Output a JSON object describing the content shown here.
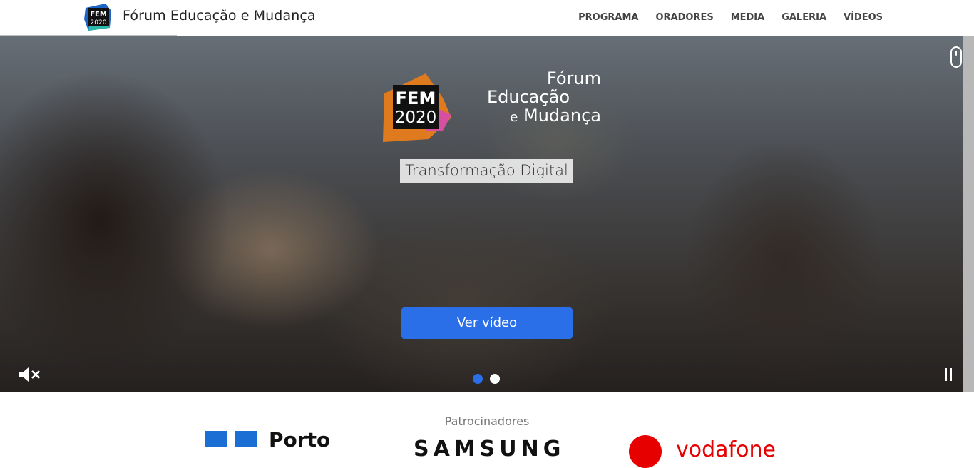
{
  "header": {
    "title": "Fórum Educação e Mudança",
    "logo_text_top": "FEM",
    "logo_text_bottom": "2020",
    "nav": [
      "PROGRAMA",
      "ORADORES",
      "MEDIA",
      "GALERIA",
      "VÍDEOS"
    ]
  },
  "hero": {
    "logo_top": "FEM",
    "logo_bottom": "2020",
    "brand_line1": "Fórum",
    "brand_line2": "Educação",
    "brand_line3_small": "e",
    "brand_line3": "Mudança",
    "subtitle": "Transformação Digital",
    "cta_label": "Ver vídeo",
    "slides": 2,
    "active_slide": 1,
    "icons": [
      "mute-icon",
      "pause-icon",
      "scroll-mouse-icon"
    ]
  },
  "sponsors": {
    "title": "Patrocinadores",
    "items": [
      "Porto",
      "SAMSUNG",
      "vodafone"
    ]
  },
  "colors": {
    "accent": "#2a6ee8",
    "logo_orange": "#e07a1f",
    "logo_pink": "#d64fa0",
    "vodafone_red": "#e60000"
  }
}
